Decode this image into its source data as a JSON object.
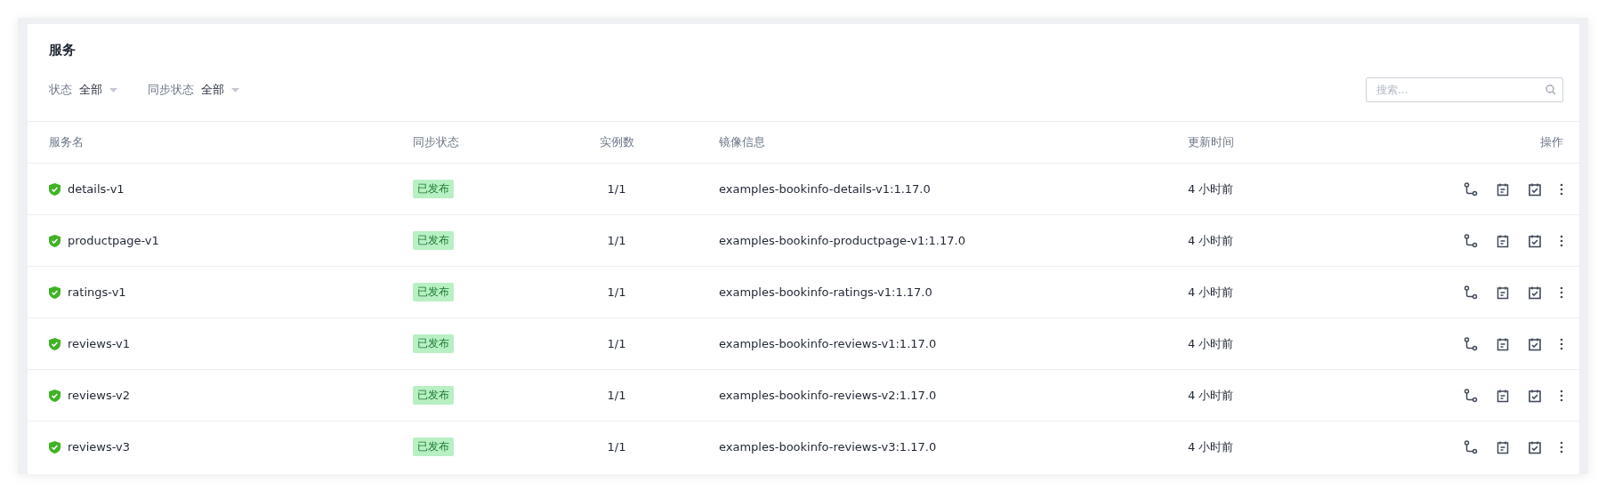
{
  "title": "服务",
  "filters": [
    {
      "label": "状态",
      "value": "全部"
    },
    {
      "label": "同步状态",
      "value": "全部"
    }
  ],
  "search": {
    "placeholder": "搜索..."
  },
  "table": {
    "columns": [
      "服务名",
      "同步状态",
      "实例数",
      "镜像信息",
      "更新时间",
      "操作"
    ],
    "rows": [
      {
        "name": "details-v1",
        "healthy": true,
        "sync": "已发布",
        "published": true,
        "instances": "1/1",
        "image": "examples-bookinfo-details-v1:1.17.0",
        "updated": "4 小时前"
      },
      {
        "name": "productpage-v1",
        "healthy": true,
        "sync": "已发布",
        "published": true,
        "instances": "1/1",
        "image": "examples-bookinfo-productpage-v1:1.17.0",
        "updated": "4 小时前"
      },
      {
        "name": "ratings-v1",
        "healthy": true,
        "sync": "已发布",
        "published": true,
        "instances": "1/1",
        "image": "examples-bookinfo-ratings-v1:1.17.0",
        "updated": "4 小时前"
      },
      {
        "name": "reviews-v1",
        "healthy": true,
        "sync": "已发布",
        "published": true,
        "instances": "1/1",
        "image": "examples-bookinfo-reviews-v1:1.17.0",
        "updated": "4 小时前"
      },
      {
        "name": "reviews-v2",
        "healthy": true,
        "sync": "已发布",
        "published": true,
        "instances": "1/1",
        "image": "examples-bookinfo-reviews-v2:1.17.0",
        "updated": "4 小时前"
      },
      {
        "name": "reviews-v3",
        "healthy": true,
        "sync": "已发布",
        "published": true,
        "instances": "1/1",
        "image": "examples-bookinfo-reviews-v3:1.17.0",
        "updated": "4 小时前"
      }
    ]
  }
}
